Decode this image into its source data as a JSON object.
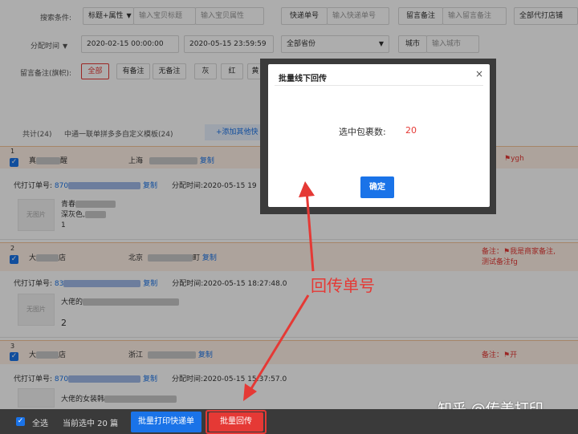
{
  "filters": {
    "search_condition_label": "搜索条件:",
    "search_type": "标题+属性",
    "title_placeholder": "输入宝贝标题",
    "attr_placeholder": "输入宝贝属性",
    "express_no_label": "快递单号",
    "express_no_placeholder": "输入快递单号",
    "remark_label": "留言备注",
    "remark_placeholder": "输入留言备注",
    "shop_select": "全部代打店铺",
    "time_type": "分配时间",
    "date_start": "2020-02-15 00:00:00",
    "date_end": "2020-05-15 23:59:59",
    "province_select": "全部省份",
    "city_label": "城市",
    "city_placeholder": "输入城市",
    "flag_label": "留言备注(旗帜):",
    "flag_chips": [
      "全部",
      "有备注",
      "无备注",
      "灰",
      "红",
      "黄"
    ]
  },
  "list_header": {
    "total": "共计(24)",
    "template": "中通一联单拼多多自定义模板(24)",
    "add_btn": "+添加其他快"
  },
  "orders": [
    {
      "index": "1",
      "shop": "真",
      "shop_tail": "醒",
      "city": "上海",
      "copy": "复制",
      "remark": "ygh",
      "order_label": "代打订单号:",
      "order_no": "870",
      "order_copy": "复制",
      "assign_time": "分配时间:2020-05-15 19",
      "item_line1": "青春",
      "item_line2": "深灰色,",
      "qty": "1",
      "thumb": "无图片"
    },
    {
      "index": "2",
      "shop": "大",
      "shop_tail": "店",
      "city": "北京",
      "city_tail": "町",
      "copy": "复制",
      "remark": "备注：",
      "remark_text": "我是商家备注,",
      "remark_text2": "测试备注fg",
      "order_label": "代打订单号:",
      "order_no": "83",
      "order_copy": "复制",
      "assign_time": "分配时间:2020-05-15 18:27:48.0",
      "item_line1": "大佬的",
      "qty": "2",
      "thumb": "无图片"
    },
    {
      "index": "3",
      "shop": "大",
      "shop_tail": "店",
      "city": "浙江",
      "copy": "复制",
      "remark": "备注：",
      "remark_text": "开",
      "order_label": "代打订单号:",
      "order_no": "870",
      "order_copy": "复制",
      "assign_time": "分配时间:2020-05-15 15:37:57.0",
      "item_line1": "大佬的女装韩"
    }
  ],
  "modal": {
    "title": "批量线下回传",
    "close": "×",
    "count_label": "选中包裹数:",
    "count_value": "20",
    "confirm": "确定"
  },
  "annotation": {
    "text": "回传单号",
    "color": "#e53935"
  },
  "bottom_bar": {
    "select_all": "全选",
    "selected_info": "当前选中 20 篇",
    "print_btn": "批量打印快递单",
    "return_btn": "批量回传"
  },
  "watermark": "知乎 @传美打印",
  "colors": {
    "accent": "#1a73e8",
    "danger": "#e53935",
    "highlight_row": "#fff1e6"
  }
}
